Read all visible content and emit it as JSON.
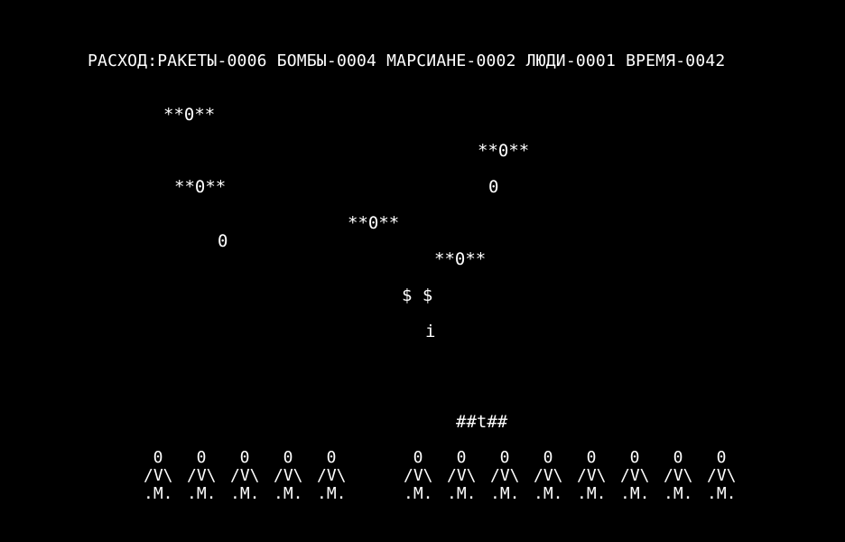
{
  "status": {
    "label": "РАСХОД:",
    "rockets": "РАКЕТЫ-0006",
    "bombs": "БОМБЫ-0004",
    "martians": "МАРСИАНЕ-0002",
    "people": "ЛЮДИ-0001",
    "time": "ВРЕМЯ-0042"
  },
  "martian_ships": [
    {
      "label": "**0**"
    },
    {
      "label": "**0**"
    },
    {
      "label": "**0**"
    },
    {
      "label": "**0**"
    },
    {
      "label": "**0**"
    }
  ],
  "falling_bombs": [
    {
      "label": "0"
    },
    {
      "label": "0"
    }
  ],
  "player_rocket": {
    "label": "$ $"
  },
  "player_shot": {
    "label": "i"
  },
  "launcher": {
    "label": "##t##"
  },
  "humans": {
    "head": "0",
    "body": "/V\\",
    "legs": ".M.",
    "left_group_count": 5,
    "right_group_count": 8
  },
  "colors": {
    "background": "#000000",
    "foreground": "#ffffff"
  }
}
